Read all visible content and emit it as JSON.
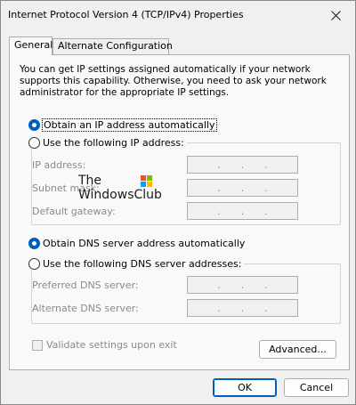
{
  "window": {
    "title": "Internet Protocol Version 4 (TCP/IPv4) Properties"
  },
  "tabs": [
    {
      "label": "General",
      "active": true
    },
    {
      "label": "Alternate Configuration",
      "active": false
    }
  ],
  "description": "You can get IP settings assigned automatically if your network supports this capability. Otherwise, you need to ask your network administrator for the appropriate IP settings.",
  "ip": {
    "auto_label": "Obtain an IP address automatically",
    "auto_selected": true,
    "manual_label": "Use the following IP address:",
    "fields": [
      {
        "label": "IP address:",
        "value": ".   .   ."
      },
      {
        "label": "Subnet mask:",
        "value": ".   .   ."
      },
      {
        "label": "Default gateway:",
        "value": ".   .   ."
      }
    ]
  },
  "dns": {
    "auto_label": "Obtain DNS server address automatically",
    "auto_selected": true,
    "manual_label": "Use the following DNS server addresses:",
    "fields": [
      {
        "label": "Preferred DNS server:",
        "value": ".   .   ."
      },
      {
        "label": "Alternate DNS server:",
        "value": ".   .   ."
      }
    ]
  },
  "validate_label": "Validate settings upon exit",
  "buttons": {
    "advanced": "Advanced...",
    "ok": "OK",
    "cancel": "Cancel"
  },
  "watermark": {
    "line1": "The",
    "line2": "WindowsClub"
  },
  "colors": {
    "accent": "#005fb8",
    "disabled_text": "#8a8a8a",
    "panel_bg": "#f9f9f9",
    "window_bg": "#f0f0f0"
  }
}
